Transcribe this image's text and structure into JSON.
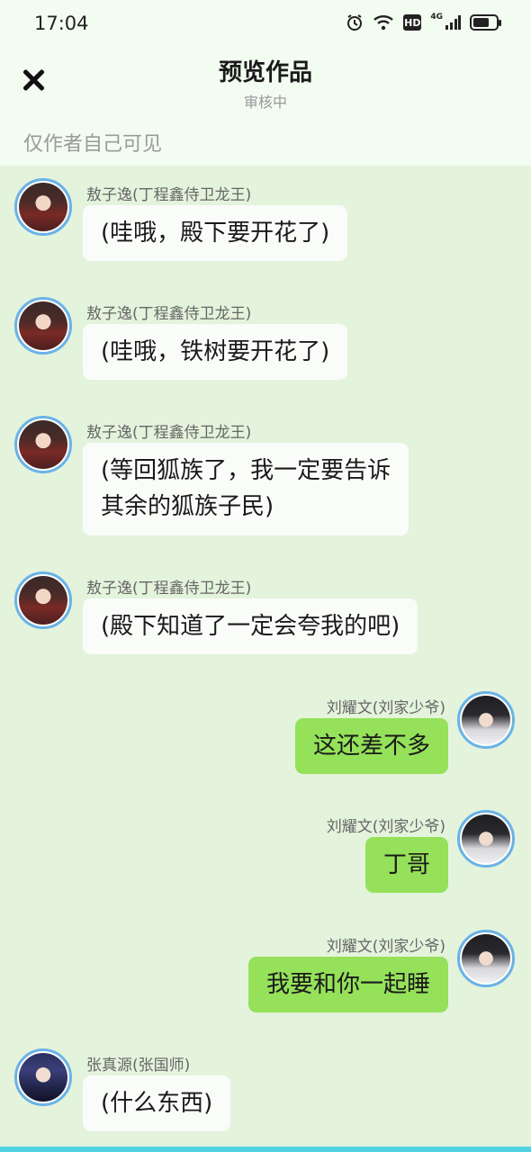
{
  "status_bar": {
    "time": "17:04",
    "icons": [
      "alarm-icon",
      "wifi-icon",
      "hd-icon",
      "signal-4g-icon",
      "battery-icon"
    ],
    "hd_label": "HD",
    "network_label": "4G",
    "battery_level_percent": 80
  },
  "header": {
    "title": "预览作品",
    "subtitle": "审核中",
    "visibility_note": "仅作者自己可见",
    "close_icon": "close-icon"
  },
  "colors": {
    "chat_background": "#e3f3dc",
    "header_background": "#f3fcf1",
    "right_bubble": "#95e15a",
    "left_bubble": "#fafcf9",
    "avatar_ring": "#6ab2e6"
  },
  "messages": [
    {
      "side": "left",
      "sender": "敖子逸(丁程鑫侍卫龙王)",
      "text": "(哇哦，殿下要开花了)",
      "avatar": "avatar-aoziyi"
    },
    {
      "side": "left",
      "sender": "敖子逸(丁程鑫侍卫龙王)",
      "text": "(哇哦，铁树要开花了)",
      "avatar": "avatar-aoziyi"
    },
    {
      "side": "left",
      "sender": "敖子逸(丁程鑫侍卫龙王)",
      "text": "(等回狐族了，我一定要告诉\n其余的狐族子民)",
      "avatar": "avatar-aoziyi"
    },
    {
      "side": "left",
      "sender": "敖子逸(丁程鑫侍卫龙王)",
      "text": "(殿下知道了一定会夸我的吧)",
      "avatar": "avatar-aoziyi"
    },
    {
      "side": "right",
      "sender": "刘耀文(刘家少爷)",
      "text": "这还差不多",
      "avatar": "avatar-liuyaowen"
    },
    {
      "side": "right",
      "sender": "刘耀文(刘家少爷)",
      "text": "丁哥",
      "avatar": "avatar-liuyaowen"
    },
    {
      "side": "right",
      "sender": "刘耀文(刘家少爷)",
      "text": "我要和你一起睡",
      "avatar": "avatar-liuyaowen"
    },
    {
      "side": "left",
      "sender": "张真源(张国师)",
      "text": "(什么东西)",
      "avatar": "avatar-zhangzhenyuan"
    }
  ]
}
